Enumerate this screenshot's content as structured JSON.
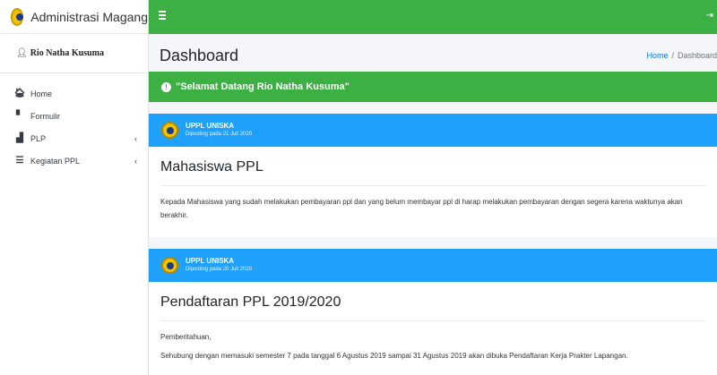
{
  "sidebar": {
    "brand": "Administrasi Magang",
    "user_name": "Rio Natha Kusuma",
    "items": [
      {
        "label": "Home",
        "icon": "home-icon",
        "glyph": "🏠︎",
        "has_chevron": false
      },
      {
        "label": "Formulir",
        "icon": "file-icon",
        "glyph": "▘",
        "has_chevron": false
      },
      {
        "label": "PLP",
        "icon": "building-icon",
        "glyph": "▟",
        "has_chevron": true
      },
      {
        "label": "Kegiatan PPL",
        "icon": "list-icon",
        "glyph": "☰",
        "has_chevron": true
      }
    ],
    "chevron": "‹"
  },
  "topbar": {
    "menu_icon": "hamburger-icon",
    "logout_icon": "sign-out-icon",
    "logout_glyph": "⇥"
  },
  "header": {
    "title": "Dashboard",
    "breadcrumb": {
      "home": "Home",
      "separator": "/",
      "current": "Dashboard"
    }
  },
  "alert": {
    "icon_glyph": "!",
    "text": "\"Selamat Datang Rio Natha Kusuma\""
  },
  "posts": [
    {
      "author": "UPPL UNISKA",
      "date": "Diposting pada 21 Juli 2020",
      "title": "Mahasiswa PPL",
      "paragraphs": [
        "Kepada Mahasiswa yang sudah melakukan pembayaran ppl dan yang belum membayar ppl di harap melakukan pembayaran dengan segera karena waktunya akan berakhir."
      ]
    },
    {
      "author": "UPPL UNISKA",
      "date": "Diposting pada 20 Juli 2020",
      "title": "Pendaftaran PPL 2019/2020",
      "paragraphs": [
        "Pemberitahuan,",
        "Sehubung dengan memasuki semester 7 pada tanggal 6 Agustus 2019 sampai 31 Agustus 2019 akan dibuka Pendaftaran Kerja Prakter Lapangan."
      ]
    }
  ],
  "colors": {
    "green": "#3cb043",
    "blue": "#1ea0fb",
    "link": "#007bff"
  }
}
